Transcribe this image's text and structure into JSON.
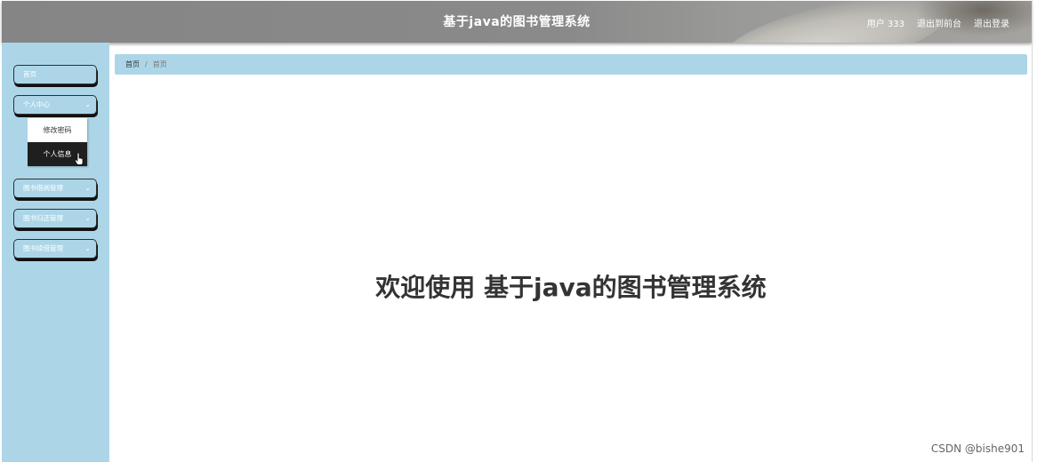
{
  "header": {
    "title": "基于java的图书管理系统",
    "user_label": "用户 333",
    "to_frontend": "退出到前台",
    "logout": "退出登录"
  },
  "sidebar": {
    "items": [
      {
        "label": "首页",
        "has_chevron": false
      },
      {
        "label": "个人中心",
        "has_chevron": true,
        "expanded": true,
        "submenu": [
          {
            "label": "修改密码",
            "active": false
          },
          {
            "label": "个人信息",
            "active": true
          }
        ]
      },
      {
        "label": "图书借阅管理",
        "has_chevron": true
      },
      {
        "label": "图书归还管理",
        "has_chevron": true
      },
      {
        "label": "图书续借管理",
        "has_chevron": true
      }
    ],
    "chevron_glyph": "⌄"
  },
  "breadcrumb": {
    "home": "首页",
    "current": "首页"
  },
  "main": {
    "welcome": "欢迎使用 基于java的图书管理系统"
  },
  "watermark": "CSDN @bishe901",
  "colors": {
    "header_bg": "#858585",
    "sidebar_bg": "#acd6e8",
    "accent_dark": "#1f1f1f",
    "text_dark": "#333333"
  }
}
